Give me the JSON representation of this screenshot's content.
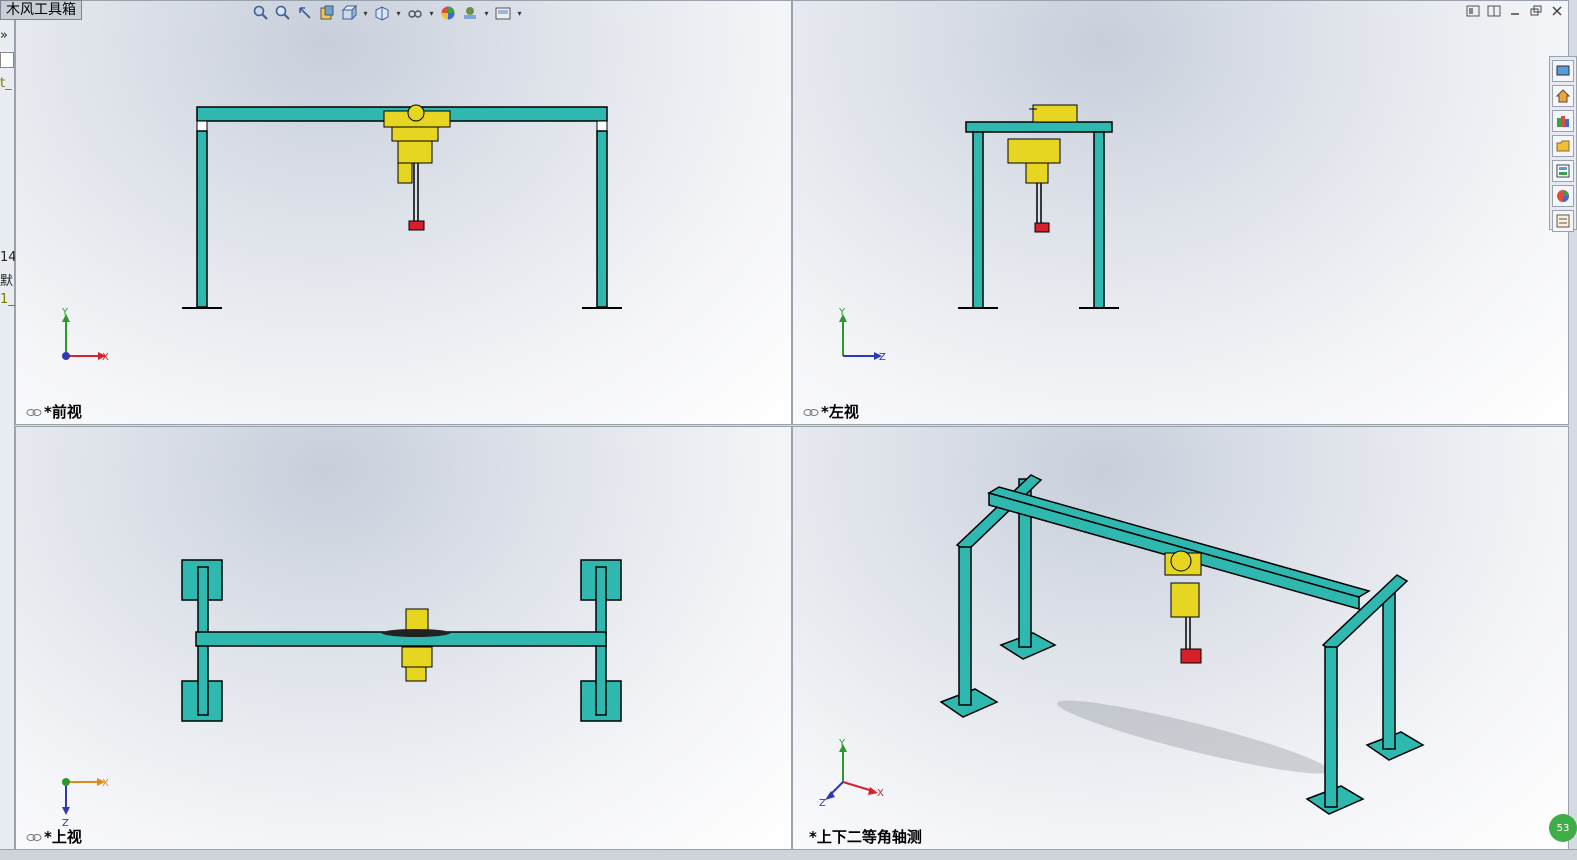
{
  "toolbox": {
    "title": "木风工具箱",
    "strip_glyph_top": "»",
    "strip_fragments": [
      "t_",
      "14",
      "默",
      "1_"
    ]
  },
  "viewports": {
    "front": {
      "label": "*前视"
    },
    "left": {
      "label": "*左视"
    },
    "top": {
      "label": "*上视"
    },
    "iso": {
      "label": "*上下二等角轴测"
    }
  },
  "status": {
    "badge": "53"
  },
  "colors": {
    "beam": "#2fb8b0",
    "hoist": "#e6d622",
    "hook_block": "#d6202a",
    "outline": "#000000"
  }
}
